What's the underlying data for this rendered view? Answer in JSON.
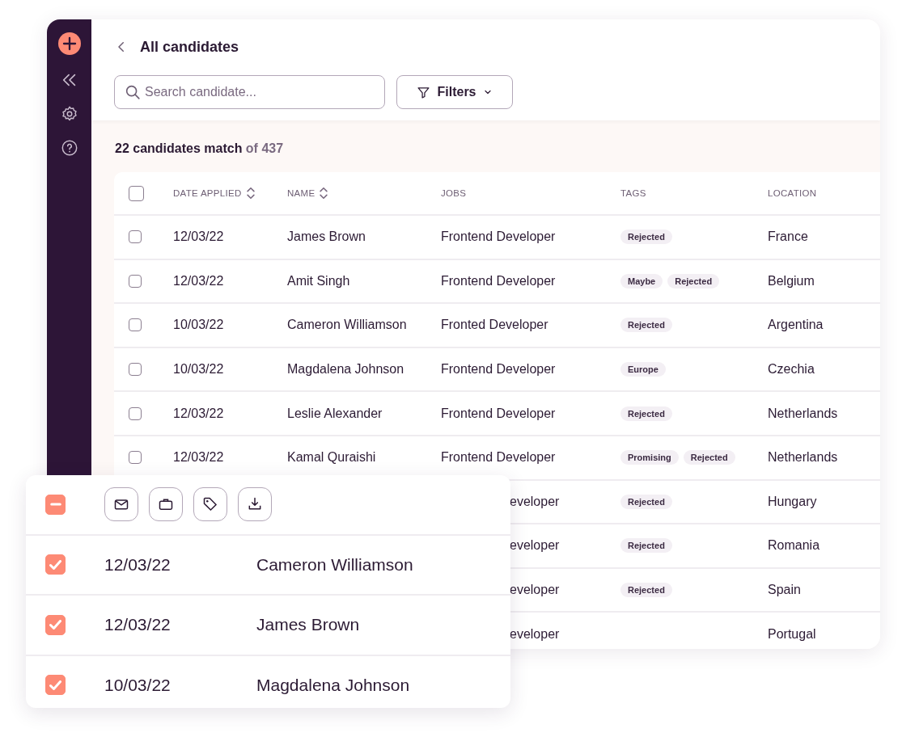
{
  "header": {
    "title": "All candidates",
    "search": {
      "placeholder": "Search candidate..."
    },
    "filters_button": "Filters"
  },
  "summary": {
    "count": "22 candidates match",
    "total": "of 437"
  },
  "table": {
    "select_all": {
      "checked": false
    },
    "columns": [
      {
        "label": "DATE APPLIED",
        "sortable": true
      },
      {
        "label": "NAME",
        "sortable": true
      },
      {
        "label": "JOBS",
        "sortable": false
      },
      {
        "label": "TAGS",
        "sortable": false
      },
      {
        "label": "LOCATION",
        "sortable": false
      }
    ],
    "rows": [
      {
        "checked": false,
        "date": "12/03/22",
        "name": "James Brown",
        "job": "Frontend Developer",
        "tags": [
          "Rejected"
        ],
        "location": "France"
      },
      {
        "checked": false,
        "date": "12/03/22",
        "name": "Amit Singh",
        "job": "Frontend Developer",
        "tags": [
          "Maybe",
          "Rejected"
        ],
        "location": "Belgium"
      },
      {
        "checked": false,
        "date": "10/03/22",
        "name": "Cameron Williamson",
        "job": "Fronted Developer",
        "tags": [
          "Rejected"
        ],
        "location": "Argentina"
      },
      {
        "checked": false,
        "date": "10/03/22",
        "name": "Magdalena Johnson",
        "job": "Frontend Developer",
        "tags": [
          "Europe"
        ],
        "location": "Czechia"
      },
      {
        "checked": false,
        "date": "12/03/22",
        "name": "Leslie Alexander",
        "job": "Frontend Developer",
        "tags": [
          "Rejected"
        ],
        "location": "Netherlands"
      },
      {
        "checked": false,
        "date": "12/03/22",
        "name": "Kamal Quraishi",
        "job": "Frontend Developer",
        "tags": [
          "Promising",
          "Rejected"
        ],
        "location": "Netherlands"
      },
      {
        "covered": true,
        "job": "eveloper",
        "tags": [
          "Rejected"
        ],
        "location": "Hungary"
      },
      {
        "covered": true,
        "job": "eveloper",
        "tags": [
          "Rejected"
        ],
        "location": "Romania"
      },
      {
        "covered": true,
        "job": "eveloper",
        "tags": [
          "Rejected"
        ],
        "location": "Spain"
      },
      {
        "covered": true,
        "job": "eveloper",
        "tags": [],
        "location": "Portugal"
      }
    ]
  },
  "selection_panel": {
    "select_all": {
      "indeterminate": true
    },
    "rows": [
      {
        "checked": true,
        "date": "12/03/22",
        "name": "Cameron Williamson"
      },
      {
        "checked": true,
        "date": "12/03/22",
        "name": "James Brown"
      },
      {
        "checked": true,
        "date": "10/03/22",
        "name": "Magdalena Johnson"
      }
    ]
  }
}
